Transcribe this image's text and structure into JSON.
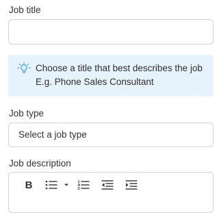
{
  "job_title": {
    "label": "Job title",
    "value": "",
    "placeholder": ""
  },
  "tip": {
    "line1": "Choose a title that best describes the job",
    "line2": "E.g. Phone Sales Consultant",
    "icon": "lightbulb-icon",
    "background_color": "#e6f3fc",
    "icon_color": "#3d9be0"
  },
  "job_type": {
    "label": "Job type",
    "selected": "Select a job type"
  },
  "job_description": {
    "label": "Job description",
    "toolbar": {
      "bold_label": "B",
      "icons": [
        "bold-icon",
        "bulleted-list-icon",
        "dropdown-caret-icon",
        "numbered-list-icon",
        "outdent-icon",
        "indent-icon"
      ]
    }
  }
}
